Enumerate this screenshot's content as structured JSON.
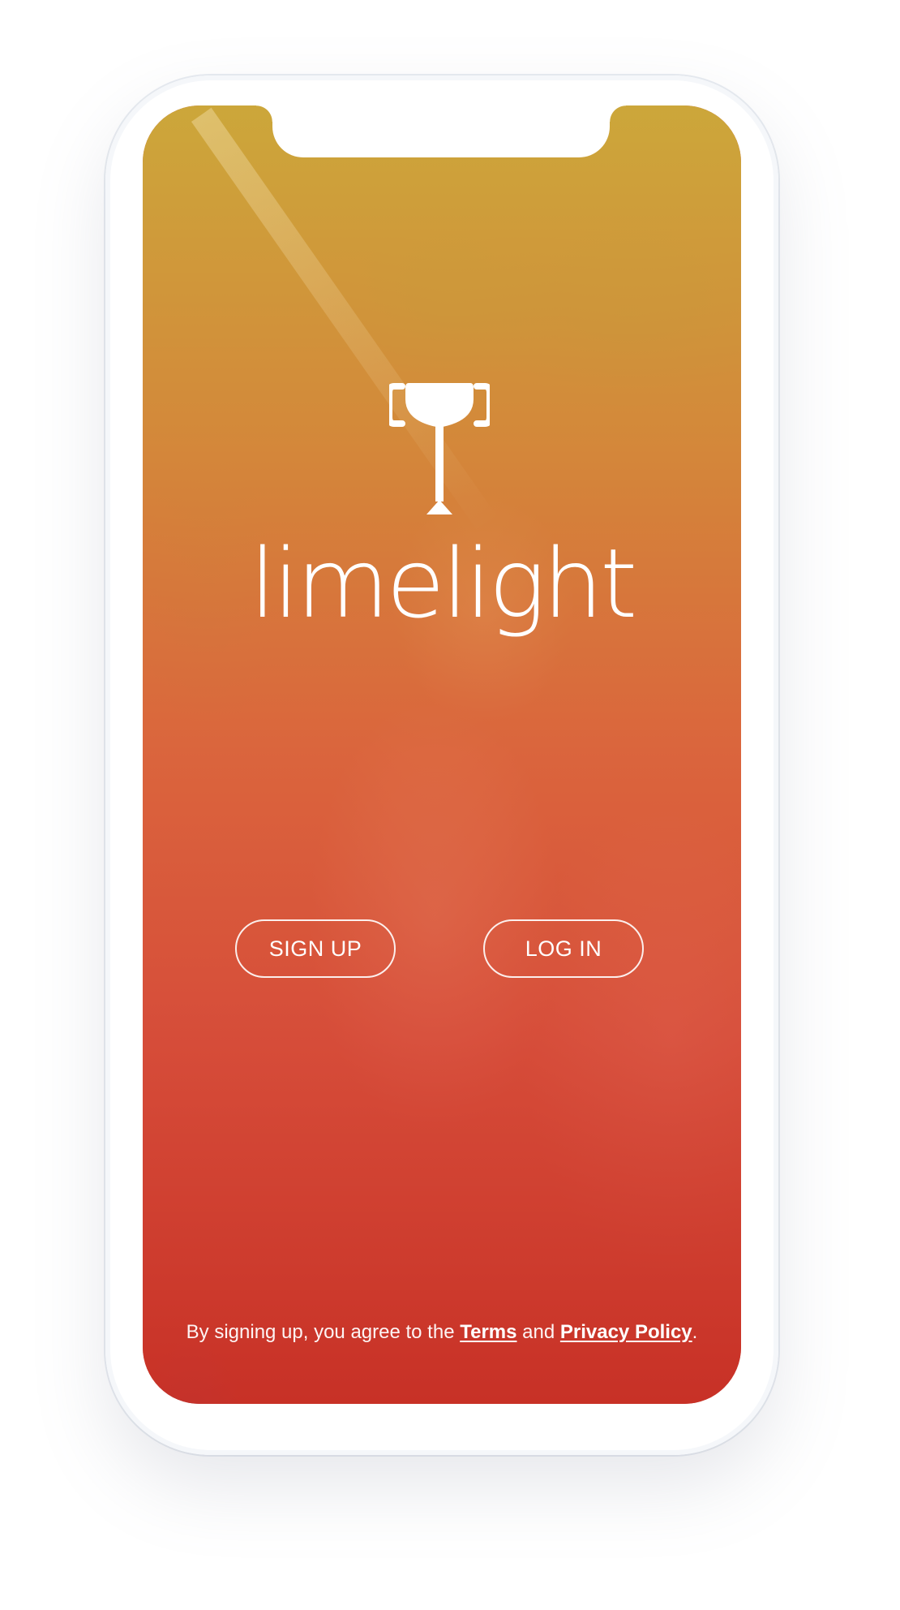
{
  "app": {
    "name": "limelight"
  },
  "auth": {
    "signup_label": "SIGN UP",
    "login_label": "LOG IN"
  },
  "legal": {
    "prefix": "By signing up, you agree to the ",
    "terms_label": "Terms",
    "middle": " and ",
    "privacy_label": "Privacy Policy",
    "suffix": "."
  },
  "colors": {
    "overlay_top": "#cdb03c",
    "overlay_bottom": "#c8302a",
    "text": "#ffffff"
  },
  "icons": {
    "logo": "wine-glass-camera-icon"
  }
}
